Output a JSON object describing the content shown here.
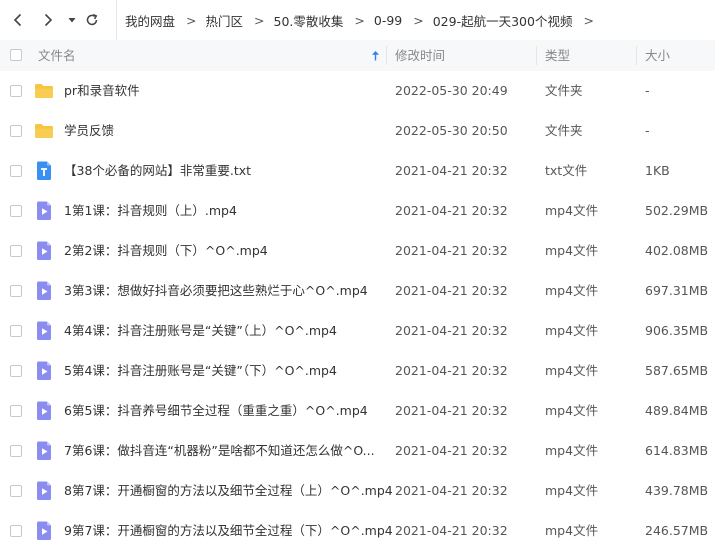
{
  "breadcrumb": [
    "我的网盘",
    "热门区",
    "50.零散收集",
    "0-99",
    "029-起航一天300个视频"
  ],
  "breadcrumb_separator": ">",
  "columns": {
    "name": "文件名",
    "modified": "修改时间",
    "type": "类型",
    "size": "大小"
  },
  "sort_icon": "up-arrow-icon",
  "colors": {
    "folder": "#f7c443",
    "txt": "#3a8ff0",
    "mp4": "#8a8cf0",
    "header_bg": "#f7f8fa",
    "sort_arrow": "#2f80ed"
  },
  "files": [
    {
      "icon": "folder-icon",
      "name": "pr和录音软件",
      "time": "2022-05-30 20:49",
      "type": "文件夹",
      "size": "-"
    },
    {
      "icon": "folder-icon",
      "name": "学员反馈",
      "time": "2022-05-30 20:50",
      "type": "文件夹",
      "size": "-"
    },
    {
      "icon": "txt-file-icon",
      "name": "【38个必备的网站】非常重要.txt",
      "time": "2021-04-21 20:32",
      "type": "txt文件",
      "size": "1KB"
    },
    {
      "icon": "video-file-icon",
      "name": "1第1课：抖音规则（上）.mp4",
      "time": "2021-04-21 20:32",
      "type": "mp4文件",
      "size": "502.29MB"
    },
    {
      "icon": "video-file-icon",
      "name": "2第2课：抖音规则（下）^O^.mp4",
      "time": "2021-04-21 20:32",
      "type": "mp4文件",
      "size": "402.08MB"
    },
    {
      "icon": "video-file-icon",
      "name": "3第3课：想做好抖音必须要把这些熟烂于心^O^.mp4",
      "time": "2021-04-21 20:32",
      "type": "mp4文件",
      "size": "697.31MB"
    },
    {
      "icon": "video-file-icon",
      "name": "4第4课：抖音注册账号是“关键”（上）^O^.mp4",
      "time": "2021-04-21 20:32",
      "type": "mp4文件",
      "size": "906.35MB"
    },
    {
      "icon": "video-file-icon",
      "name": "5第4课：抖音注册账号是“关键”（下）^O^.mp4",
      "time": "2021-04-21 20:32",
      "type": "mp4文件",
      "size": "587.65MB"
    },
    {
      "icon": "video-file-icon",
      "name": "6第5课：抖音养号细节全过程（重重之重）^O^.mp4",
      "time": "2021-04-21 20:32",
      "type": "mp4文件",
      "size": "489.84MB"
    },
    {
      "icon": "video-file-icon",
      "name": "7第6课：做抖音连“机器粉”是啥都不知道还怎么做^O...",
      "time": "2021-04-21 20:32",
      "type": "mp4文件",
      "size": "614.83MB"
    },
    {
      "icon": "video-file-icon",
      "name": "8第7课：开通橱窗的方法以及细节全过程（上）^O^.mp4",
      "time": "2021-04-21 20:32",
      "type": "mp4文件",
      "size": "439.78MB"
    },
    {
      "icon": "video-file-icon",
      "name": "9第7课：开通橱窗的方法以及细节全过程（下）^O^.mp4",
      "time": "2021-04-21 20:32",
      "type": "mp4文件",
      "size": "246.57MB"
    }
  ]
}
